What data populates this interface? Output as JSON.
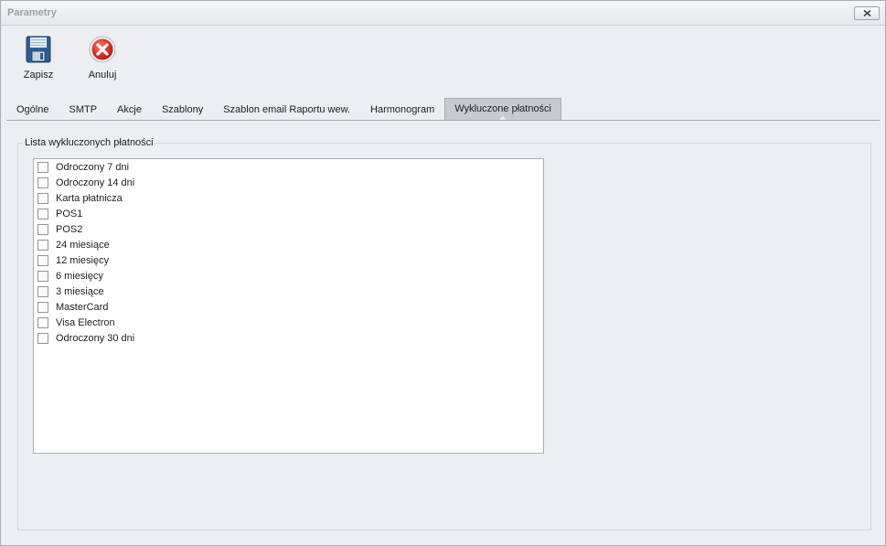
{
  "window": {
    "title": "Parametry"
  },
  "toolbar": {
    "save_label": "Zapisz",
    "cancel_label": "Anuluj"
  },
  "tabs": [
    {
      "label": "Ogólne",
      "active": false
    },
    {
      "label": "SMTP",
      "active": false
    },
    {
      "label": "Akcje",
      "active": false
    },
    {
      "label": "Szablony",
      "active": false
    },
    {
      "label": "Szablon email Raportu wew.",
      "active": false
    },
    {
      "label": "Harmonogram",
      "active": false
    },
    {
      "label": "Wykluczone płatności",
      "active": true
    }
  ],
  "group": {
    "title": "Lista wykluczonych płatności",
    "items": [
      {
        "label": "Odroczony 7 dni",
        "checked": false
      },
      {
        "label": "Odroczony 14 dni",
        "checked": false
      },
      {
        "label": "Karta płatnicza",
        "checked": false
      },
      {
        "label": "POS1",
        "checked": false
      },
      {
        "label": "POS2",
        "checked": false
      },
      {
        "label": "24 miesiące",
        "checked": false
      },
      {
        "label": "12 miesięcy",
        "checked": false
      },
      {
        "label": "6 miesięcy",
        "checked": false
      },
      {
        "label": "3 miesiące",
        "checked": false
      },
      {
        "label": "MasterCard",
        "checked": false
      },
      {
        "label": "Visa Electron",
        "checked": false
      },
      {
        "label": "Odroczony 30 dni",
        "checked": false
      }
    ]
  },
  "icons": {
    "save": "floppy-disk-icon",
    "cancel": "cancel-x-icon",
    "close": "close-icon"
  },
  "colors": {
    "cancel_red": "#d9302a",
    "save_blue": "#2d5f94",
    "active_tab": "#c7cbd1"
  }
}
